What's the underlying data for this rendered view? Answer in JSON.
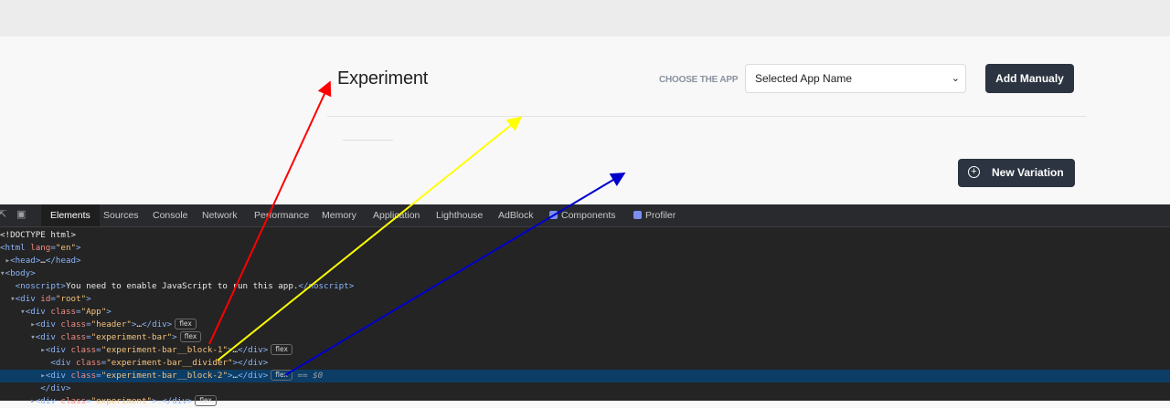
{
  "app": {
    "experiment_title": "Experiment",
    "choose_label": "CHOOSE THE APP",
    "select_value": "Selected App Name",
    "add_button": "Add Manualy",
    "new_variation_button": "New Variation"
  },
  "devtools": {
    "tabs": [
      "Elements",
      "Sources",
      "Console",
      "Network",
      "Performance",
      "Memory",
      "Application",
      "Lighthouse",
      "AdBlock",
      "Components",
      "Profiler"
    ],
    "active_tab": "Elements",
    "selected_suffix": "== $0",
    "pill": "flex"
  },
  "annotations": {
    "colors": [
      "#ff0000",
      "#ffff00",
      "#0000cc"
    ]
  }
}
